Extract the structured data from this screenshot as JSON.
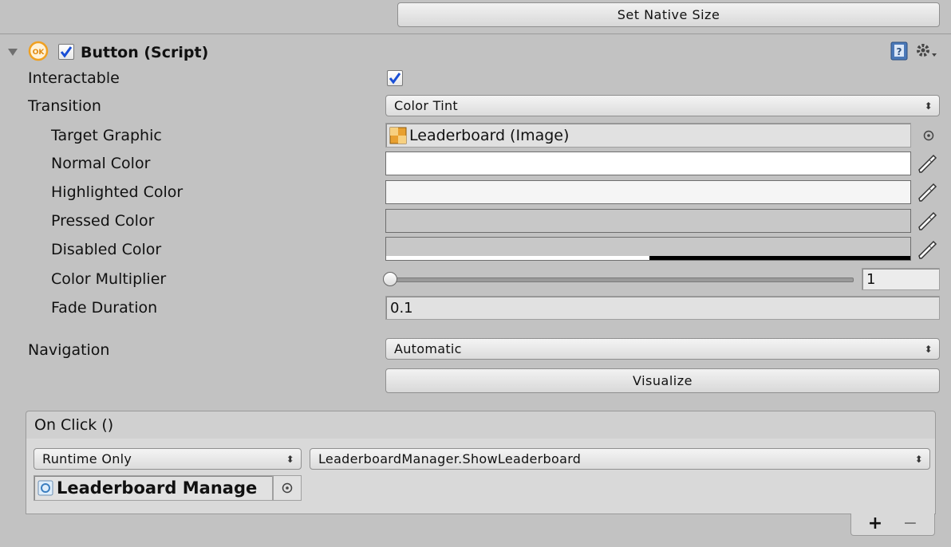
{
  "top_button": {
    "label": "Set Native Size"
  },
  "component": {
    "title": "Button (Script)",
    "enabled": true,
    "icon_badge": "OK"
  },
  "properties": {
    "interactable": {
      "label": "Interactable",
      "checked": true
    },
    "transition": {
      "label": "Transition",
      "value": "Color Tint"
    },
    "target_graphic": {
      "label": "Target Graphic",
      "value": "Leaderboard (Image)"
    },
    "normal_color": {
      "label": "Normal Color",
      "color": "#ffffff"
    },
    "highlighted_color": {
      "label": "Highlighted Color",
      "color": "#f5f5f5"
    },
    "pressed_color": {
      "label": "Pressed Color",
      "color": "#c8c8c8"
    },
    "disabled_color": {
      "label": "Disabled Color",
      "color": "#c8c8c8",
      "alpha": 0.5
    },
    "color_multiplier": {
      "label": "Color Multiplier",
      "value": "1"
    },
    "fade_duration": {
      "label": "Fade Duration",
      "value": "0.1"
    },
    "navigation": {
      "label": "Navigation",
      "value": "Automatic"
    },
    "visualize": {
      "label": "Visualize"
    }
  },
  "on_click": {
    "header": "On Click ()",
    "runtime": "Runtime Only",
    "function": "LeaderboardManager.ShowLeaderboard",
    "object": "Leaderboard Manage",
    "add": "+",
    "remove": "−"
  },
  "icons": {
    "foldout": "foldout-arrow-icon",
    "help": "help-book-icon",
    "gear": "gear-menu-icon",
    "eyedropper": "eyedropper-icon",
    "object_picker": "object-picker-icon"
  }
}
